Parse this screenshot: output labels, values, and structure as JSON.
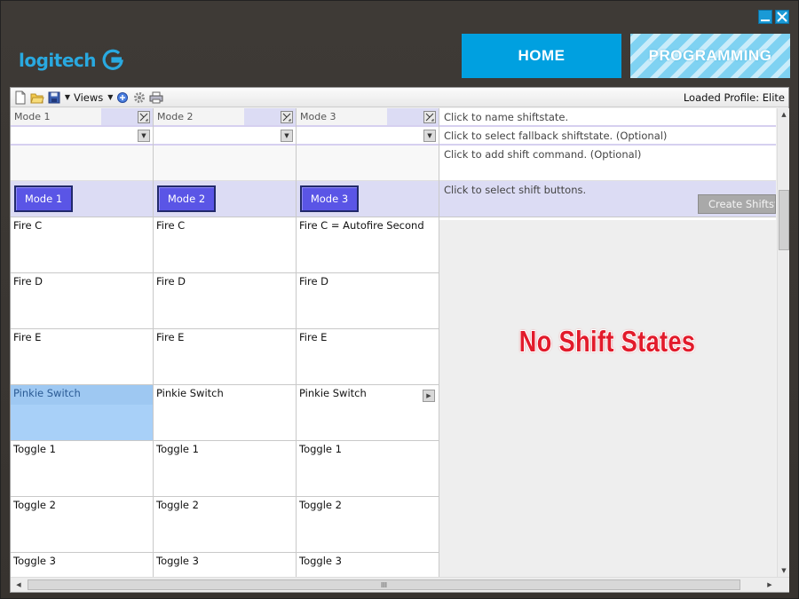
{
  "window": {
    "minimize_icon": "minimize-icon",
    "close_icon": "close-icon"
  },
  "brand": {
    "logo_text": "logitech",
    "logo_mark": "logitech-g-icon",
    "accent": "#29a9e0"
  },
  "nav": {
    "home_label": "HOME",
    "programming_label": "PROGRAMMING"
  },
  "toolbar": {
    "icons": [
      "new-file-icon",
      "open-folder-icon",
      "save-icon",
      "script-icon",
      "settings-gear-icon",
      "print-icon"
    ],
    "views_label": "Views",
    "loaded_profile": "Loaded Profile: Elite"
  },
  "modes": [
    {
      "name": "Mode 1",
      "button": "Mode 1",
      "cells": [
        "Fire C",
        "Fire D",
        "Fire E",
        "Pinkie Switch",
        "Toggle 1",
        "Toggle 2",
        "Toggle 3"
      ]
    },
    {
      "name": "Mode 2",
      "button": "Mode 2",
      "cells": [
        "Fire C",
        "Fire D",
        "Fire E",
        "Pinkie Switch",
        "Toggle 1",
        "Toggle 2",
        "Toggle 3"
      ]
    },
    {
      "name": "Mode 3",
      "button": "Mode 3",
      "cells": [
        "Fire C = Autofire Second",
        "Fire D",
        "Fire E",
        "Pinkie Switch",
        "Toggle 1",
        "Toggle 2",
        "Toggle 3"
      ]
    }
  ],
  "shift": {
    "name_prompt": "Click to name shiftstate.",
    "fallback_prompt": "Click to select fallback shiftstate. (Optional)",
    "command_prompt": "Click to add shift command. (Optional)",
    "buttons_prompt": "Click to select shift buttons.",
    "create_button": "Create Shiftstate",
    "empty_message": "No Shift States"
  },
  "scrollbar": {
    "h_thumb_grip": "III"
  },
  "colors": {
    "mode_button": "#5a55e6",
    "selected_cell": "#a8d0f8",
    "home_tab": "#00a0e0",
    "empty_message": "#e21b2b"
  }
}
